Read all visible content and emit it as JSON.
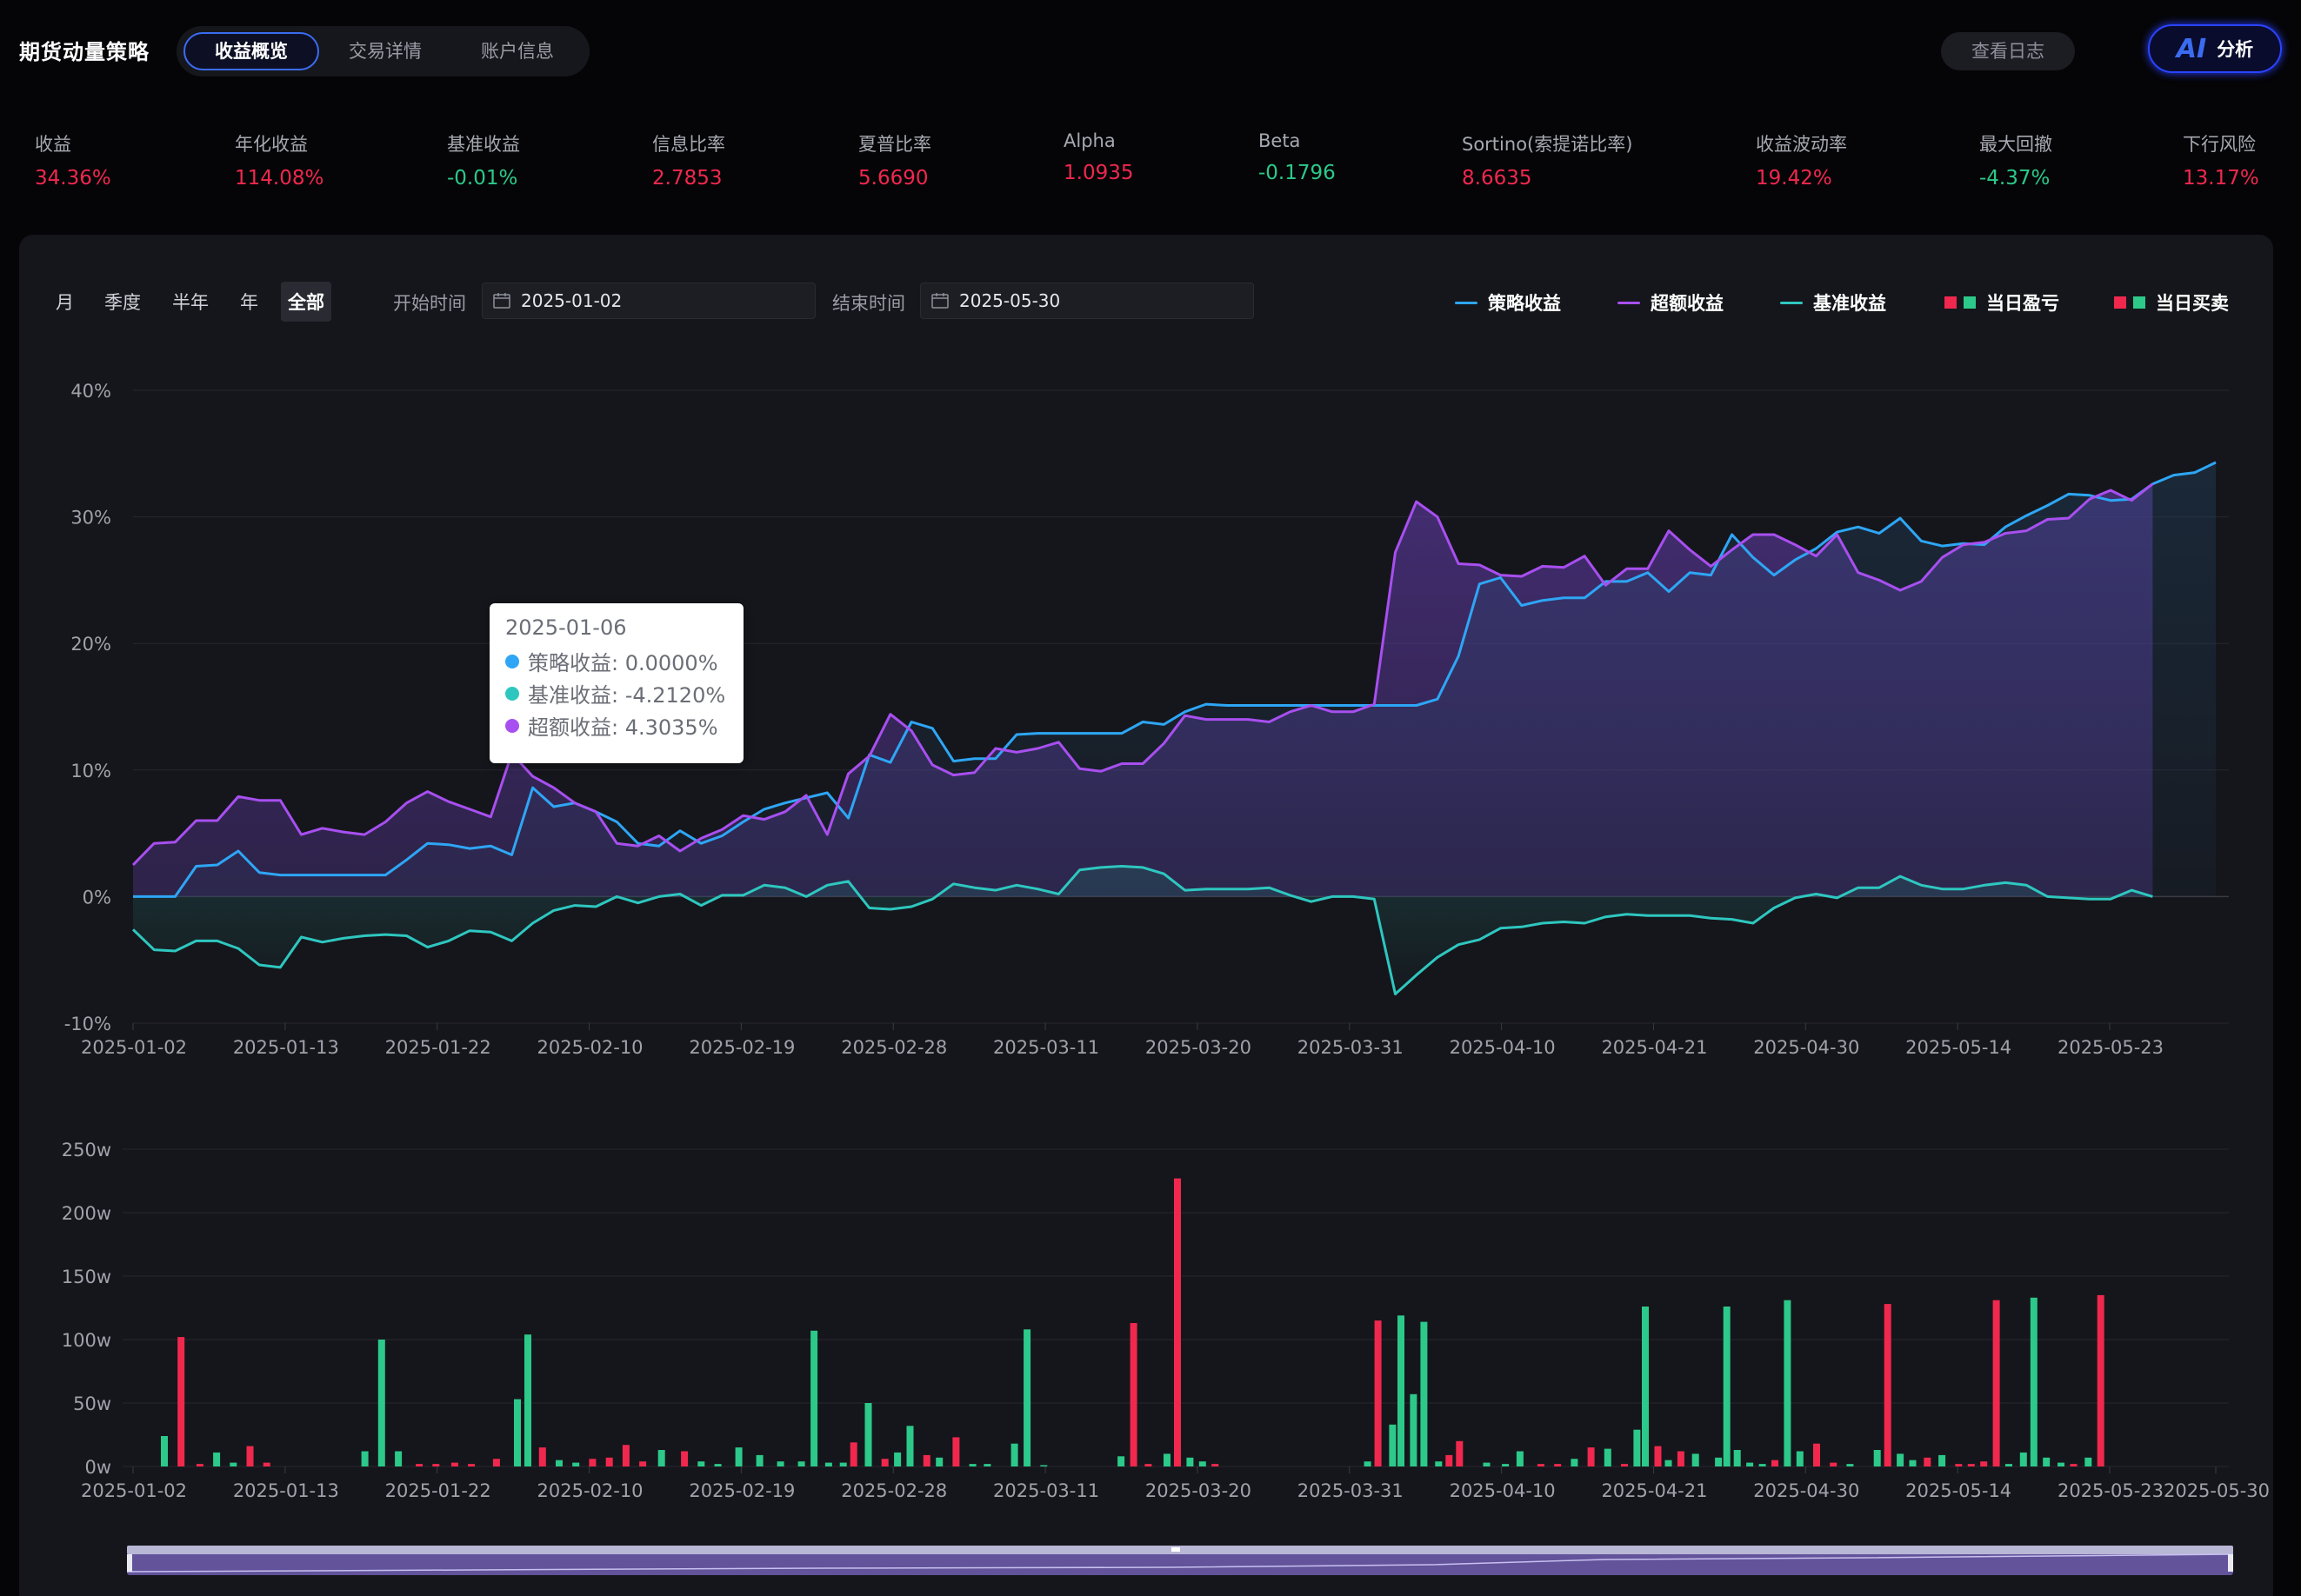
{
  "app": {
    "title": "期货动量策略"
  },
  "tabs": [
    {
      "label": "收益概览",
      "active": true
    },
    {
      "label": "交易详情",
      "active": false
    },
    {
      "label": "账户信息",
      "active": false
    }
  ],
  "header": {
    "log_label": "查看日志",
    "ai_logo": "AI",
    "ai_label": "分析"
  },
  "metrics": [
    {
      "label": "收益",
      "value": "34.36%",
      "tone": "pos"
    },
    {
      "label": "年化收益",
      "value": "114.08%",
      "tone": "pos"
    },
    {
      "label": "基准收益",
      "value": "-0.01%",
      "tone": "neg"
    },
    {
      "label": "信息比率",
      "value": "2.7853",
      "tone": "pos"
    },
    {
      "label": "夏普比率",
      "value": "5.6690",
      "tone": "pos"
    },
    {
      "label": "Alpha",
      "value": "1.0935",
      "tone": "pos"
    },
    {
      "label": "Beta",
      "value": "-0.1796",
      "tone": "neg"
    },
    {
      "label": "Sortino(索提诺比率)",
      "value": "8.6635",
      "tone": "pos"
    },
    {
      "label": "收益波动率",
      "value": "19.42%",
      "tone": "pos"
    },
    {
      "label": "最大回撤",
      "value": "-4.37%",
      "tone": "neg"
    },
    {
      "label": "下行风险",
      "value": "13.17%",
      "tone": "pos"
    }
  ],
  "periods": [
    {
      "label": "月",
      "active": false
    },
    {
      "label": "季度",
      "active": false
    },
    {
      "label": "半年",
      "active": false
    },
    {
      "label": "年",
      "active": false
    },
    {
      "label": "全部",
      "active": true
    }
  ],
  "range": {
    "start_label": "开始时间",
    "start_value": "2025-01-02",
    "end_label": "结束时间",
    "end_value": "2025-05-30"
  },
  "legend": [
    {
      "label": "策略收益",
      "kind": "line",
      "color": "#2ea6f5"
    },
    {
      "label": "超额收益",
      "kind": "line",
      "color": "#a84ff0"
    },
    {
      "label": "基准收益",
      "kind": "line",
      "color": "#2ec7c0"
    },
    {
      "label": "当日盈亏",
      "kind": "bar",
      "colors": [
        "#f0284e",
        "#2cc98a"
      ]
    },
    {
      "label": "当日买卖",
      "kind": "bar",
      "colors": [
        "#f0284e",
        "#2cc98a"
      ]
    }
  ],
  "tooltip": {
    "date": "2025-01-06",
    "rows": [
      {
        "label": "策略收益: 0.0000%",
        "color": "#2ea6f5"
      },
      {
        "label": "基准收益: -4.2120%",
        "color": "#2ec7c0"
      },
      {
        "label": "超额收益: 4.3035%",
        "color": "#a84ff0"
      }
    ]
  },
  "colors": {
    "strategy": "#2ea6f5",
    "excess": "#a84ff0",
    "benchmark": "#2ec7c0",
    "up": "#f0284e",
    "down": "#2cc98a"
  },
  "chart_data": [
    {
      "type": "line",
      "y_ticks": [
        "40%",
        "30%",
        "20%",
        "10%",
        "0%",
        "-10%"
      ],
      "ylim": [
        -10,
        40
      ],
      "x_ticks": [
        "2025-01-02",
        "2025-01-13",
        "2025-01-22",
        "2025-02-10",
        "2025-02-19",
        "2025-02-28",
        "2025-03-11",
        "2025-03-20",
        "2025-03-31",
        "2025-04-10",
        "2025-04-21",
        "2025-04-30",
        "2025-05-14",
        "2025-05-23"
      ],
      "series": [
        {
          "name": "策略收益",
          "values": [
            0,
            0,
            0,
            2.4,
            2.5,
            3.6,
            1.9,
            1.7,
            1.7,
            1.7,
            1.7,
            1.7,
            1.7,
            2.9,
            4.2,
            4.1,
            3.8,
            4.0,
            3.3,
            8.6,
            7.1,
            7.4,
            6.7,
            5.9,
            4.2,
            4.0,
            5.2,
            4.2,
            4.8,
            5.9,
            6.9,
            7.4,
            7.8,
            8.2,
            6.2,
            11.2,
            10.6,
            13.8,
            13.3,
            10.7,
            10.9,
            10.9,
            12.8,
            12.9,
            12.9,
            12.9,
            12.9,
            12.9,
            13.8,
            13.6,
            14.6,
            15.2,
            15.1,
            15.1,
            15.1,
            15.1,
            15.1,
            15.1,
            15.1,
            15.1,
            15.1,
            15.1,
            15.6,
            19.0,
            24.7,
            25.2,
            23.0,
            23.4,
            23.6,
            23.6,
            24.9,
            24.9,
            25.6,
            24.1,
            25.6,
            25.4,
            28.6,
            26.8,
            25.4,
            26.6,
            27.5,
            28.8,
            29.2,
            28.7,
            29.9,
            28.1,
            27.7,
            27.9,
            27.8,
            29.2,
            30.1,
            30.9,
            31.8,
            31.7,
            31.3,
            31.4,
            32.6,
            33.3,
            33.5,
            34.3
          ]
        },
        {
          "name": "超额收益",
          "values": [
            2.5,
            4.2,
            4.3,
            6.0,
            6.0,
            7.9,
            7.6,
            7.6,
            4.9,
            5.4,
            5.1,
            4.9,
            5.9,
            7.4,
            8.3,
            7.5,
            6.9,
            6.3,
            11.3,
            9.5,
            8.6,
            7.4,
            6.7,
            4.2,
            4.0,
            4.8,
            3.6,
            4.6,
            5.3,
            6.4,
            6.1,
            6.7,
            8.0,
            4.9,
            9.7,
            11.1,
            14.4,
            13.1,
            10.4,
            9.6,
            9.8,
            11.7,
            11.4,
            11.7,
            12.2,
            10.1,
            9.9,
            10.5,
            10.5,
            12.1,
            14.3,
            14.0,
            14.0,
            14.0,
            13.8,
            14.6,
            15.1,
            14.6,
            14.6,
            15.2,
            27.2,
            31.2,
            30.0,
            26.3,
            26.2,
            25.4,
            25.3,
            26.1,
            26.0,
            26.9,
            24.6,
            25.9,
            25.9,
            28.9,
            27.4,
            26.1,
            27.4,
            28.6,
            28.6,
            27.8,
            26.9,
            28.6,
            25.6,
            25.0,
            24.2,
            24.9,
            26.8,
            27.8,
            28.0,
            28.7,
            28.9,
            29.8,
            29.9,
            31.4,
            32.1,
            31.3,
            32.6
          ]
        },
        {
          "name": "基准收益",
          "values": [
            -2.6,
            -4.2,
            -4.3,
            -3.5,
            -3.5,
            -4.1,
            -5.4,
            -5.6,
            -3.2,
            -3.6,
            -3.3,
            -3.1,
            -3.0,
            -3.1,
            -4.0,
            -3.5,
            -2.7,
            -2.8,
            -3.5,
            -2.1,
            -1.1,
            -0.7,
            -0.8,
            0,
            -0.5,
            0,
            0.2,
            -0.7,
            0.1,
            0.1,
            0.9,
            0.7,
            0,
            0.9,
            1.2,
            -0.9,
            -1.0,
            -0.8,
            -0.2,
            1.0,
            0.7,
            0.5,
            0.9,
            0.6,
            0.2,
            2.1,
            2.3,
            2.4,
            2.3,
            1.8,
            0.5,
            0.6,
            0.6,
            0.6,
            0.7,
            0.1,
            -0.4,
            0,
            0,
            -0.2,
            -7.7,
            -6.2,
            -4.8,
            -3.8,
            -3.4,
            -2.5,
            -2.4,
            -2.1,
            -2.0,
            -2.1,
            -1.6,
            -1.4,
            -1.5,
            -1.5,
            -1.5,
            -1.7,
            -1.8,
            -2.1,
            -0.9,
            -0.1,
            0.2,
            -0.1,
            0.7,
            0.7,
            1.6,
            0.9,
            0.6,
            0.6,
            0.9,
            1.1,
            0.9,
            0,
            -0.1,
            -0.2,
            -0.2,
            0.5,
            0
          ]
        }
      ]
    },
    {
      "type": "bar",
      "y_ticks": [
        "250w",
        "200w",
        "150w",
        "100w",
        "50w",
        "0w"
      ],
      "ylim": [
        0,
        250
      ],
      "x_ticks": [
        "2025-01-02",
        "2025-01-13",
        "2025-01-22",
        "2025-02-10",
        "2025-02-19",
        "2025-02-28",
        "2025-03-11",
        "2025-03-20",
        "2025-03-31",
        "2025-04-10",
        "2025-04-21",
        "2025-04-30",
        "2025-05-14",
        "2025-05-23",
        "2025-05-30"
      ],
      "bars": [
        {
          "x": 1.5,
          "v": 24,
          "s": "down"
        },
        {
          "x": 2.3,
          "v": 102,
          "s": "up"
        },
        {
          "x": 3.2,
          "v": 2,
          "s": "up"
        },
        {
          "x": 4.0,
          "v": 11,
          "s": "down"
        },
        {
          "x": 4.8,
          "v": 3,
          "s": "down"
        },
        {
          "x": 5.6,
          "v": 16,
          "s": "up"
        },
        {
          "x": 6.4,
          "v": 3,
          "s": "up"
        },
        {
          "x": 11.1,
          "v": 12,
          "s": "down"
        },
        {
          "x": 11.9,
          "v": 100,
          "s": "down"
        },
        {
          "x": 12.7,
          "v": 12,
          "s": "down"
        },
        {
          "x": 13.7,
          "v": 2,
          "s": "up"
        },
        {
          "x": 14.5,
          "v": 2,
          "s": "up"
        },
        {
          "x": 15.4,
          "v": 3,
          "s": "up"
        },
        {
          "x": 16.2,
          "v": 2,
          "s": "up"
        },
        {
          "x": 17.4,
          "v": 6,
          "s": "up"
        },
        {
          "x": 18.4,
          "v": 53,
          "s": "down"
        },
        {
          "x": 18.9,
          "v": 104,
          "s": "down"
        },
        {
          "x": 19.6,
          "v": 15,
          "s": "up"
        },
        {
          "x": 20.4,
          "v": 5,
          "s": "down"
        },
        {
          "x": 21.2,
          "v": 3,
          "s": "down"
        },
        {
          "x": 22.0,
          "v": 6,
          "s": "up"
        },
        {
          "x": 22.8,
          "v": 7,
          "s": "up"
        },
        {
          "x": 23.6,
          "v": 17,
          "s": "up"
        },
        {
          "x": 24.4,
          "v": 4,
          "s": "up"
        },
        {
          "x": 25.3,
          "v": 13,
          "s": "down"
        },
        {
          "x": 26.4,
          "v": 12,
          "s": "up"
        },
        {
          "x": 27.2,
          "v": 4,
          "s": "down"
        },
        {
          "x": 28.0,
          "v": 2,
          "s": "down"
        },
        {
          "x": 29.0,
          "v": 15,
          "s": "down"
        },
        {
          "x": 30.0,
          "v": 9,
          "s": "down"
        },
        {
          "x": 31.0,
          "v": 4,
          "s": "down"
        },
        {
          "x": 32.0,
          "v": 4,
          "s": "down"
        },
        {
          "x": 32.6,
          "v": 107,
          "s": "down"
        },
        {
          "x": 33.3,
          "v": 3,
          "s": "down"
        },
        {
          "x": 34.0,
          "v": 3,
          "s": "down"
        },
        {
          "x": 34.5,
          "v": 19,
          "s": "up"
        },
        {
          "x": 35.2,
          "v": 50,
          "s": "down"
        },
        {
          "x": 36.0,
          "v": 6,
          "s": "up"
        },
        {
          "x": 36.6,
          "v": 11,
          "s": "down"
        },
        {
          "x": 37.2,
          "v": 32,
          "s": "down"
        },
        {
          "x": 38.0,
          "v": 9,
          "s": "up"
        },
        {
          "x": 38.6,
          "v": 7,
          "s": "down"
        },
        {
          "x": 39.4,
          "v": 23,
          "s": "up"
        },
        {
          "x": 40.2,
          "v": 2,
          "s": "down"
        },
        {
          "x": 40.9,
          "v": 2,
          "s": "down"
        },
        {
          "x": 42.2,
          "v": 18,
          "s": "down"
        },
        {
          "x": 42.8,
          "v": 108,
          "s": "down"
        },
        {
          "x": 43.6,
          "v": 1,
          "s": "down"
        },
        {
          "x": 47.3,
          "v": 8,
          "s": "down"
        },
        {
          "x": 47.9,
          "v": 113,
          "s": "up"
        },
        {
          "x": 48.6,
          "v": 2,
          "s": "up"
        },
        {
          "x": 49.5,
          "v": 10,
          "s": "down"
        },
        {
          "x": 50.0,
          "v": 227,
          "s": "up"
        },
        {
          "x": 50.6,
          "v": 7,
          "s": "down"
        },
        {
          "x": 51.2,
          "v": 4,
          "s": "down"
        },
        {
          "x": 51.8,
          "v": 2,
          "s": "up"
        },
        {
          "x": 59.1,
          "v": 4,
          "s": "down"
        },
        {
          "x": 59.6,
          "v": 115,
          "s": "up"
        },
        {
          "x": 60.3,
          "v": 33,
          "s": "down"
        },
        {
          "x": 60.7,
          "v": 119,
          "s": "down"
        },
        {
          "x": 61.3,
          "v": 57,
          "s": "down"
        },
        {
          "x": 61.8,
          "v": 114,
          "s": "down"
        },
        {
          "x": 62.5,
          "v": 4,
          "s": "down"
        },
        {
          "x": 63.0,
          "v": 9,
          "s": "up"
        },
        {
          "x": 63.5,
          "v": 20,
          "s": "up"
        },
        {
          "x": 64.8,
          "v": 3,
          "s": "down"
        },
        {
          "x": 65.7,
          "v": 2,
          "s": "down"
        },
        {
          "x": 66.4,
          "v": 12,
          "s": "down"
        },
        {
          "x": 67.4,
          "v": 2,
          "s": "up"
        },
        {
          "x": 68.2,
          "v": 2,
          "s": "up"
        },
        {
          "x": 69.0,
          "v": 6,
          "s": "down"
        },
        {
          "x": 69.8,
          "v": 15,
          "s": "up"
        },
        {
          "x": 70.6,
          "v": 14,
          "s": "down"
        },
        {
          "x": 71.4,
          "v": 2,
          "s": "up"
        },
        {
          "x": 72.0,
          "v": 29,
          "s": "down"
        },
        {
          "x": 72.4,
          "v": 126,
          "s": "down"
        },
        {
          "x": 73.0,
          "v": 16,
          "s": "up"
        },
        {
          "x": 73.5,
          "v": 5,
          "s": "down"
        },
        {
          "x": 74.1,
          "v": 12,
          "s": "up"
        },
        {
          "x": 74.8,
          "v": 10,
          "s": "down"
        },
        {
          "x": 75.9,
          "v": 7,
          "s": "down"
        },
        {
          "x": 76.3,
          "v": 126,
          "s": "down"
        },
        {
          "x": 76.8,
          "v": 13,
          "s": "down"
        },
        {
          "x": 77.4,
          "v": 3,
          "s": "down"
        },
        {
          "x": 78.0,
          "v": 2,
          "s": "down"
        },
        {
          "x": 78.6,
          "v": 5,
          "s": "up"
        },
        {
          "x": 79.2,
          "v": 131,
          "s": "down"
        },
        {
          "x": 79.8,
          "v": 12,
          "s": "down"
        },
        {
          "x": 80.6,
          "v": 18,
          "s": "up"
        },
        {
          "x": 81.4,
          "v": 3,
          "s": "up"
        },
        {
          "x": 82.2,
          "v": 2,
          "s": "down"
        },
        {
          "x": 83.5,
          "v": 13,
          "s": "down"
        },
        {
          "x": 84.0,
          "v": 128,
          "s": "up"
        },
        {
          "x": 84.6,
          "v": 10,
          "s": "down"
        },
        {
          "x": 85.2,
          "v": 5,
          "s": "down"
        },
        {
          "x": 85.9,
          "v": 7,
          "s": "up"
        },
        {
          "x": 86.6,
          "v": 9,
          "s": "down"
        },
        {
          "x": 87.4,
          "v": 2,
          "s": "up"
        },
        {
          "x": 88.0,
          "v": 2,
          "s": "up"
        },
        {
          "x": 88.6,
          "v": 4,
          "s": "up"
        },
        {
          "x": 89.2,
          "v": 131,
          "s": "up"
        },
        {
          "x": 89.8,
          "v": 2,
          "s": "down"
        },
        {
          "x": 90.5,
          "v": 11,
          "s": "down"
        },
        {
          "x": 91.0,
          "v": 133,
          "s": "down"
        },
        {
          "x": 91.6,
          "v": 7,
          "s": "down"
        },
        {
          "x": 92.3,
          "v": 3,
          "s": "down"
        },
        {
          "x": 92.9,
          "v": 2,
          "s": "up"
        },
        {
          "x": 93.6,
          "v": 7,
          "s": "down"
        },
        {
          "x": 94.2,
          "v": 135,
          "s": "up"
        }
      ]
    }
  ]
}
